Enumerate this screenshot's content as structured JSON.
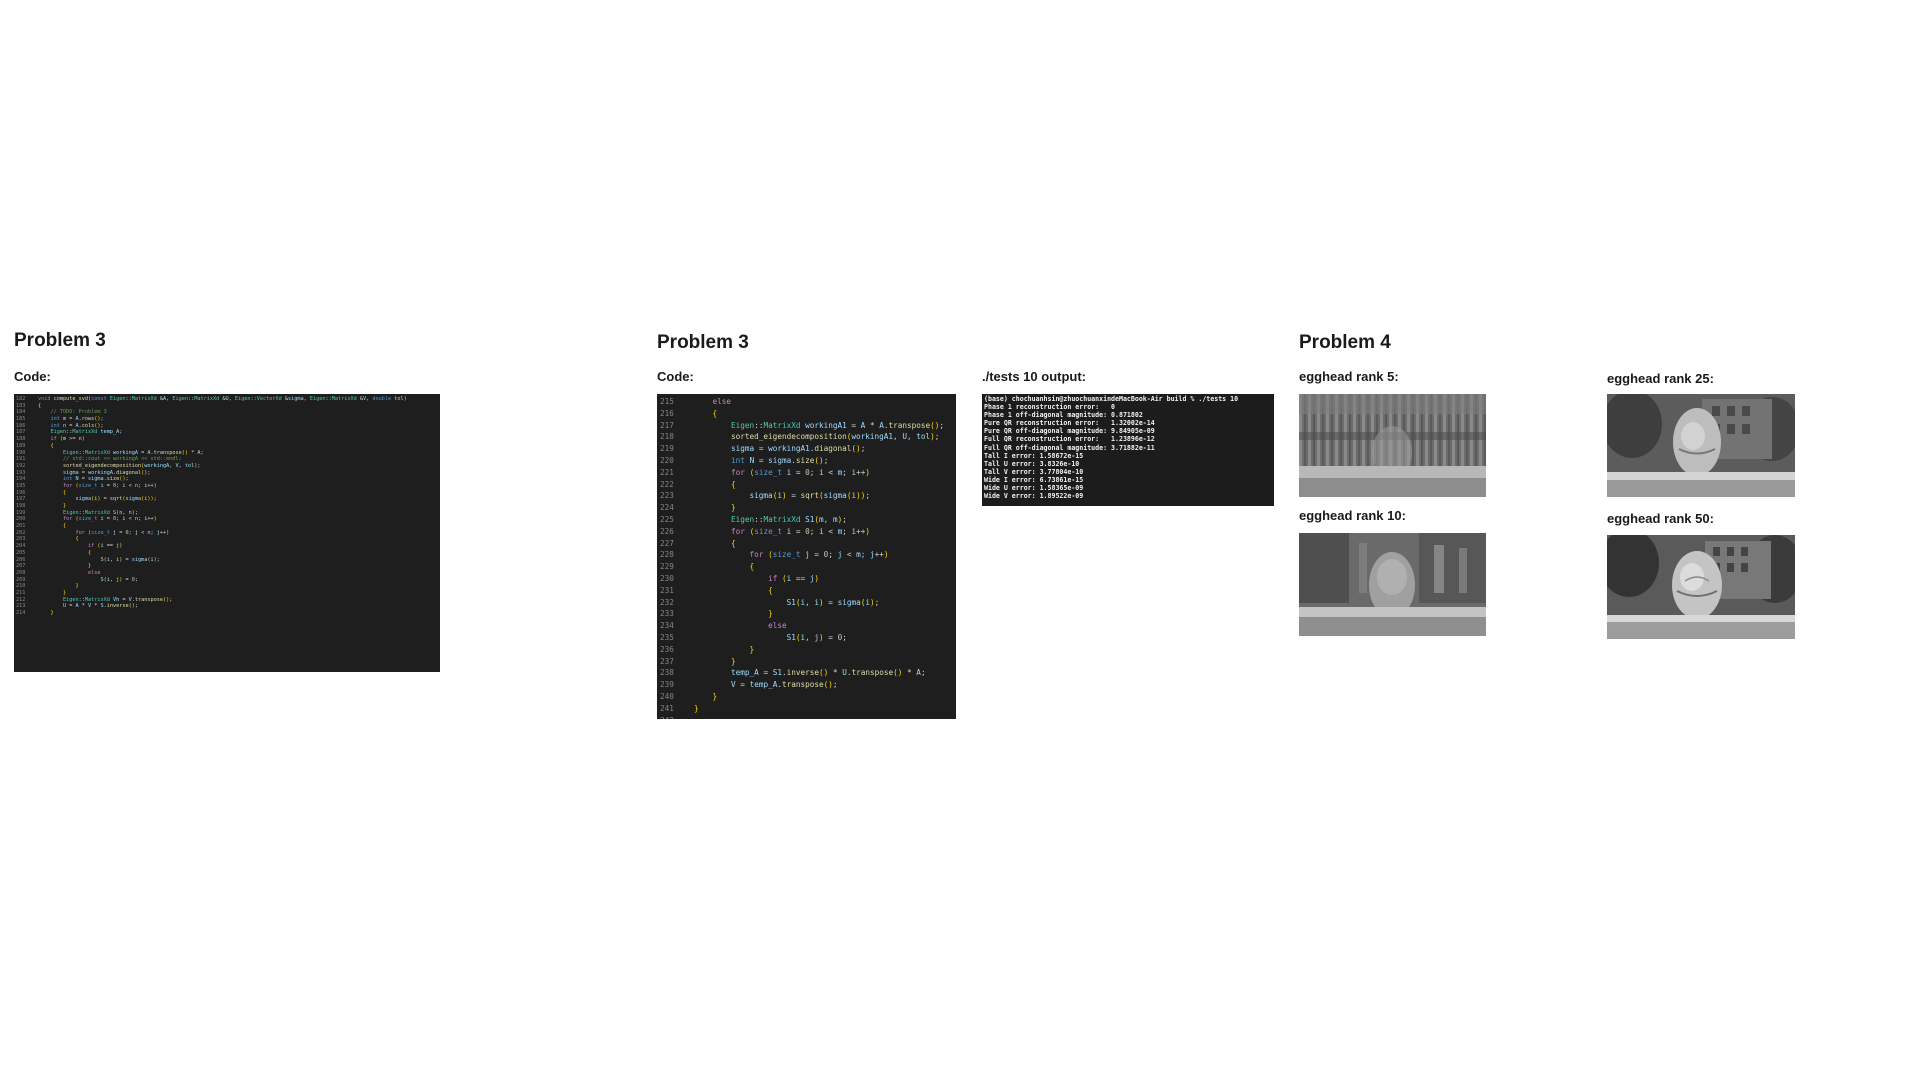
{
  "problem3a": {
    "title": "Problem 3",
    "code_label": "Code:",
    "lines": [
      {
        "n": "182",
        "t": "void compute_svd(const Eigen::MatrixXd &A, Eigen::MatrixXd &U, Eigen::VectorXd &sigma, Eigen::MatrixXd &V, double tol)"
      },
      {
        "n": "183",
        "t": "{"
      },
      {
        "n": "184",
        "t": "    // TODO: Problem 3"
      },
      {
        "n": "185",
        "t": "    int m = A.rows();"
      },
      {
        "n": "186",
        "t": "    int n = A.cols();"
      },
      {
        "n": "187",
        "t": "    Eigen::MatrixXd temp_A;"
      },
      {
        "n": "188",
        "t": "    if (m >= n)"
      },
      {
        "n": "189",
        "t": "    {"
      },
      {
        "n": "190",
        "t": "        Eigen::MatrixXd workingA = A.transpose() * A;"
      },
      {
        "n": "191",
        "t": "        // std::cout << workingA << std::endl;"
      },
      {
        "n": "192",
        "t": "        sorted_eigendecomposition(workingA, V, tol);"
      },
      {
        "n": "193",
        "t": "        sigma = workingA.diagonal();"
      },
      {
        "n": "194",
        "t": "        int N = sigma.size();"
      },
      {
        "n": "195",
        "t": "        for (size_t i = 0; i < n; i++)"
      },
      {
        "n": "196",
        "t": "        {"
      },
      {
        "n": "197",
        "t": "            sigma(i) = sqrt(sigma(i));"
      },
      {
        "n": "198",
        "t": "        }"
      },
      {
        "n": "199",
        "t": "        Eigen::MatrixXd S(n, n);"
      },
      {
        "n": "200",
        "t": "        for (size_t i = 0; i < n; i++)"
      },
      {
        "n": "201",
        "t": "        {"
      },
      {
        "n": "202",
        "t": "            for (size_t j = 0; j < n; j++)"
      },
      {
        "n": "203",
        "t": "            {"
      },
      {
        "n": "204",
        "t": "                if (i == j)"
      },
      {
        "n": "205",
        "t": "                {"
      },
      {
        "n": "206",
        "t": "                    S(i, i) = sigma(i);"
      },
      {
        "n": "207",
        "t": "                }"
      },
      {
        "n": "208",
        "t": "                else"
      },
      {
        "n": "209",
        "t": "                    S(i, j) = 0;"
      },
      {
        "n": "210",
        "t": "            }"
      },
      {
        "n": "211",
        "t": "        }"
      },
      {
        "n": "212",
        "t": "        Eigen::MatrixXd Vh = V.transpose();"
      },
      {
        "n": "213",
        "t": "        U = A * V * S.inverse();"
      },
      {
        "n": "214",
        "t": "    }"
      }
    ]
  },
  "problem3b": {
    "title": "Problem 3",
    "code_label": "Code:",
    "lines": [
      {
        "n": "215",
        "t": "    else"
      },
      {
        "n": "216",
        "t": "    {"
      },
      {
        "n": "217",
        "t": "        Eigen::MatrixXd workingA1 = A * A.transpose();"
      },
      {
        "n": "218",
        "t": "        sorted_eigendecomposition(workingA1, U, tol);"
      },
      {
        "n": "219",
        "t": "        sigma = workingA1.diagonal();"
      },
      {
        "n": "220",
        "t": "        int N = sigma.size();"
      },
      {
        "n": "221",
        "t": "        for (size_t i = 0; i < m; i++)"
      },
      {
        "n": "222",
        "t": "        {"
      },
      {
        "n": "223",
        "t": "            sigma(i) = sqrt(sigma(i));"
      },
      {
        "n": "224",
        "t": "        }"
      },
      {
        "n": "225",
        "t": "        Eigen::MatrixXd S1(m, m);"
      },
      {
        "n": "226",
        "t": "        for (size_t i = 0; i < m; i++)"
      },
      {
        "n": "227",
        "t": "        {"
      },
      {
        "n": "228",
        "t": "            for (size_t j = 0; j < m; j++)"
      },
      {
        "n": "229",
        "t": "            {"
      },
      {
        "n": "230",
        "t": "                if (i == j)"
      },
      {
        "n": "231",
        "t": "                {"
      },
      {
        "n": "232",
        "t": "                    S1(i, i) = sigma(i);"
      },
      {
        "n": "233",
        "t": "                }"
      },
      {
        "n": "234",
        "t": "                else"
      },
      {
        "n": "235",
        "t": "                    S1(i, j) = 0;"
      },
      {
        "n": "236",
        "t": "            }"
      },
      {
        "n": "237",
        "t": "        }"
      },
      {
        "n": "238",
        "t": "        temp_A = S1.inverse() * U.transpose() * A;"
      },
      {
        "n": "239",
        "t": "        V = temp_A.transpose();"
      },
      {
        "n": "240",
        "t": "    }"
      },
      {
        "n": "241",
        "t": "}"
      },
      {
        "n": "242",
        "t": ""
      }
    ]
  },
  "tests": {
    "label": "./tests 10 output:",
    "lines": [
      "(base) chochuanhsin@zhuochuanxindeMacBook-Air build % ./tests 10",
      "Phase 1 reconstruction error:   0",
      "Phase 1 off-diagonal magnitude: 0.871802",
      "Pure QR reconstruction error:   1.32002e-14",
      "Pure QR off-diagonal magnitude: 9.84905e-09",
      "Full QR reconstruction error:   1.23896e-12",
      "Full QR off-diagonal magnitude: 3.71882e-11",
      "Tall I error: 1.58672e-15",
      "Tall U error: 3.8326e-10",
      "Tall V error: 3.77804e-10",
      "Wide I error: 6.73861e-15",
      "Wide U error: 1.58365e-09",
      "Wide V error: 1.89522e-09"
    ]
  },
  "problem4": {
    "title": "Problem 4",
    "rank5": "egghead rank 5:",
    "rank10": "egghead rank 10:",
    "rank25": "egghead rank 25:",
    "rank50": "egghead rank 50:"
  }
}
